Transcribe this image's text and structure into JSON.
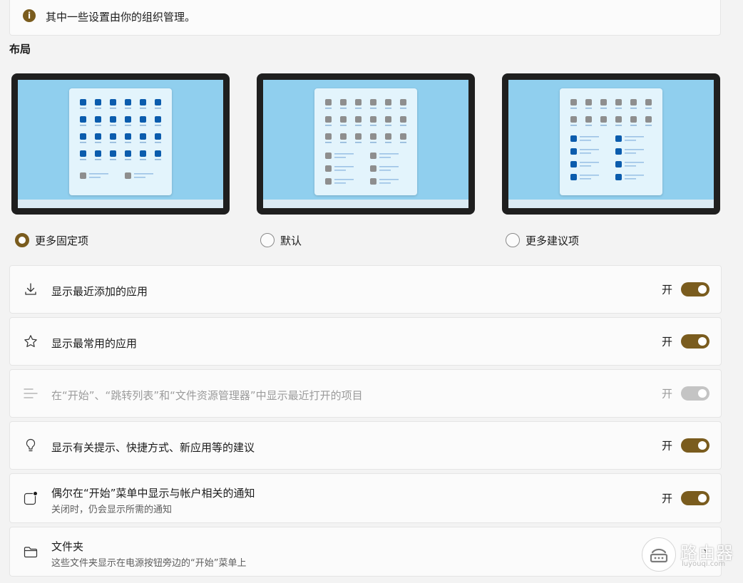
{
  "banner": {
    "icon": "info-icon",
    "text": "其中一些设置由你的组织管理。"
  },
  "layout": {
    "title": "布局",
    "options": [
      {
        "label": "更多固定项",
        "selected": true
      },
      {
        "label": "默认",
        "selected": false
      },
      {
        "label": "更多建议项",
        "selected": false
      }
    ]
  },
  "settings": [
    {
      "icon": "download-icon",
      "title": "显示最近添加的应用",
      "state": "开",
      "on": true,
      "disabled": false
    },
    {
      "icon": "star-icon",
      "title": "显示最常用的应用",
      "state": "开",
      "on": true,
      "disabled": false
    },
    {
      "icon": "list-icon",
      "title": "在“开始”、“跳转列表”和“文件资源管理器”中显示最近打开的项目",
      "state": "开",
      "on": true,
      "disabled": true
    },
    {
      "icon": "lightbulb-icon",
      "title": "显示有关提示、快捷方式、新应用等的建议",
      "state": "开",
      "on": true,
      "disabled": false
    },
    {
      "icon": "notification-icon",
      "title": "偶尔在“开始”菜单中显示与帐户相关的通知",
      "subtitle": "关闭时，仍会显示所需的通知",
      "state": "开",
      "on": true,
      "disabled": false
    },
    {
      "icon": "folder-icon",
      "title": "文件夹",
      "subtitle": "这些文件夹显示在电源按钮旁边的“开始”菜单上",
      "chevron": "›"
    }
  ],
  "watermark": {
    "text": "路由器",
    "sub": "luyouqi.com"
  },
  "colors": {
    "accent": "#7a5c1e",
    "pin_blue": "#0b5cad",
    "pin_gray": "#8e8e8e",
    "screen": "#90cfee"
  }
}
